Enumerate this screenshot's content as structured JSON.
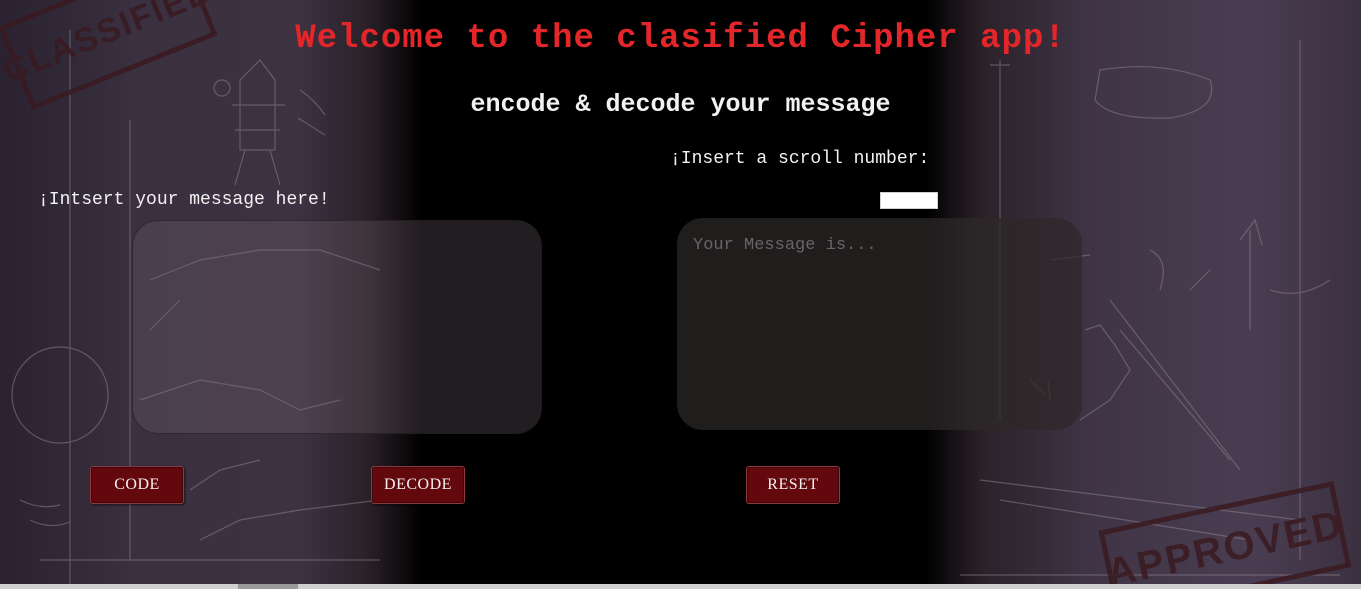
{
  "app": {
    "title": "Welcome to the clasified Cipher app!",
    "subtitle": "encode & decode your message"
  },
  "message_section": {
    "label": "¡Intsert your message here!",
    "input_value": ""
  },
  "scroll_section": {
    "label": "¡Insert a scroll number:",
    "input_value": ""
  },
  "output_section": {
    "placeholder": "Your Message is...",
    "value": ""
  },
  "buttons": {
    "code": "CODE",
    "decode": "DECODE",
    "reset": "RESET"
  },
  "stamps": {
    "top_left": "CLASSIFIED",
    "bottom_right": "APPROVED"
  },
  "colors": {
    "title_red": "#e3262a",
    "button_dark_red": "#63080d",
    "center_panel": "#000000"
  }
}
